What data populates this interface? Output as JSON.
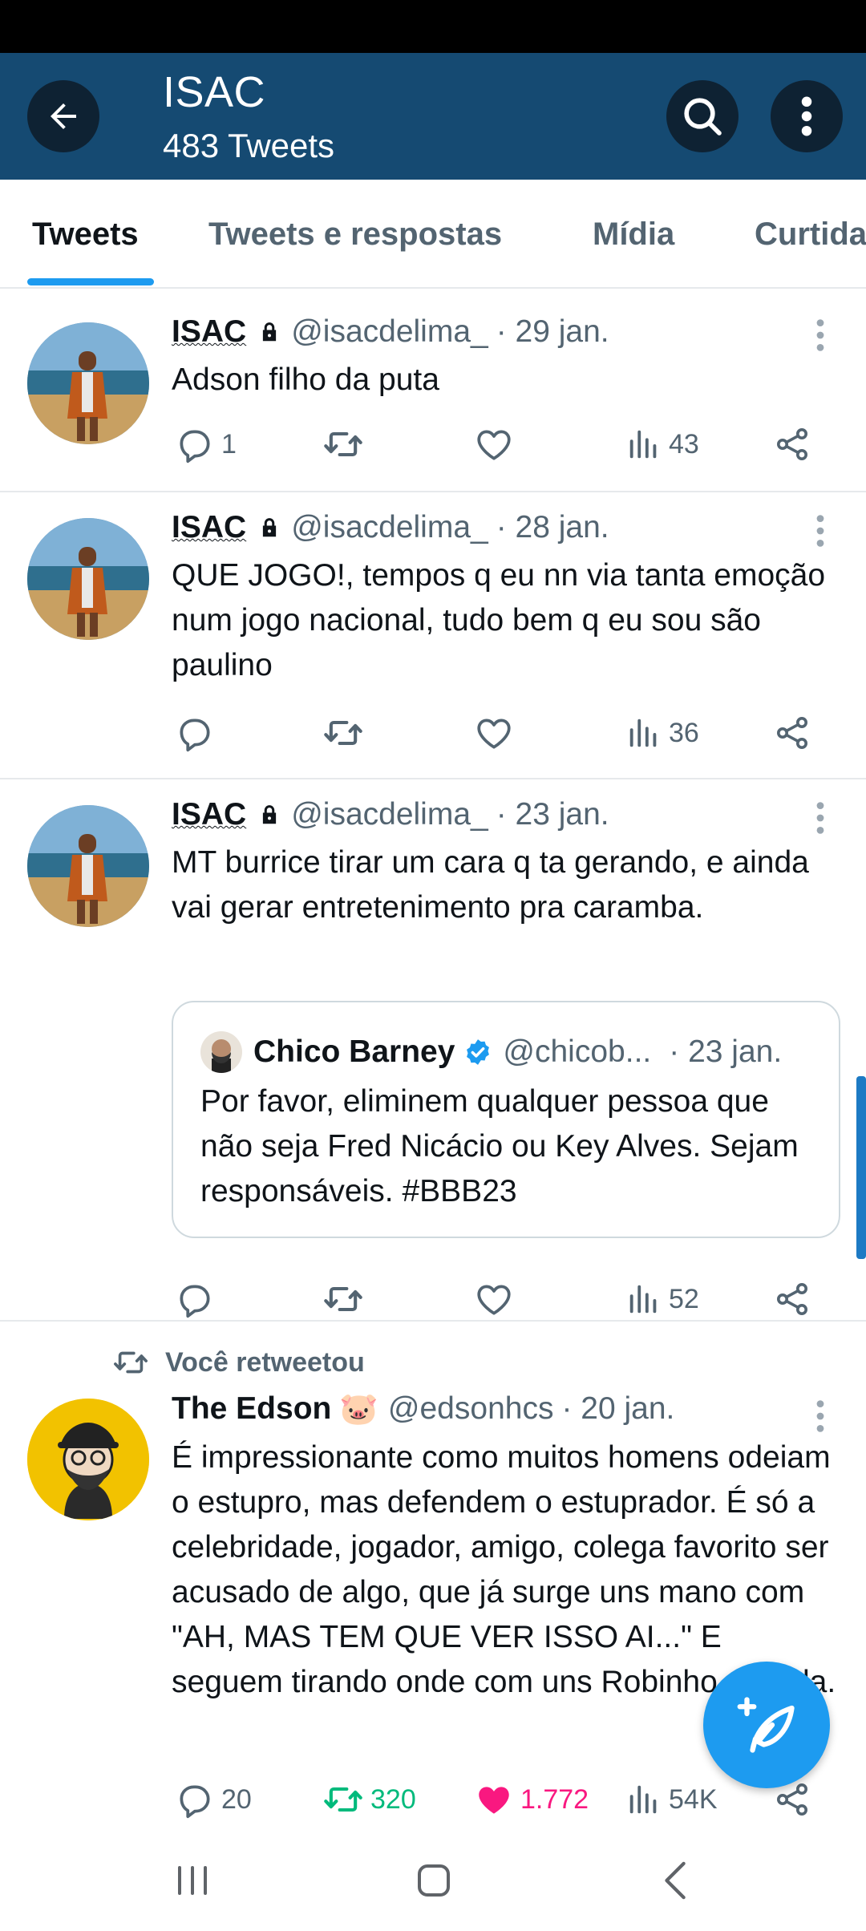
{
  "header": {
    "title": "ISAC",
    "subtitle": "483 Tweets"
  },
  "tabs": [
    {
      "label": "Tweets",
      "active": true
    },
    {
      "label": "Tweets e respostas",
      "active": false
    },
    {
      "label": "Mídia",
      "active": false
    },
    {
      "label": "Curtidas",
      "active": false
    }
  ],
  "tweets": [
    {
      "name": "ISAC",
      "protected": true,
      "handle": "@isacdelima_",
      "date": "· 29 jan.",
      "text": "Adson filho da puta",
      "replies": "1",
      "retweets": "",
      "likes": "",
      "views": "43"
    },
    {
      "name": "ISAC",
      "protected": true,
      "handle": "@isacdelima_",
      "date": "· 28 jan.",
      "text": "QUE JOGO!, tempos q eu nn via tanta emoção num jogo nacional, tudo bem q eu sou são paulino",
      "replies": "",
      "retweets": "",
      "likes": "",
      "views": "36"
    },
    {
      "name": "ISAC",
      "protected": true,
      "handle": "@isacdelima_",
      "date": "· 23 jan.",
      "text": "MT burrice tirar um cara q ta gerando, e ainda vai gerar entretenimento pra caramba.",
      "quote": {
        "name": "Chico Barney",
        "verified": true,
        "handle": "@chicob...",
        "date": "· 23 jan.",
        "text": "Por favor, eliminem qualquer pessoa que não seja Fred Nicácio ou Key Alves. Sejam responsáveis. #BBB23"
      },
      "replies": "",
      "retweets": "",
      "likes": "",
      "views": "52"
    },
    {
      "retweet_label": "Você retweetou",
      "name": "The Edson",
      "emoji": "🐷",
      "handle": "@edsonhcs",
      "date": "· 20 jan.",
      "text": "É impressionante como muitos homens odeiam o estupro, mas defendem o estuprador. É só a celebridade, jogador, amigo, colega favorito ser acusado de algo, que já surge uns mano com \"AH, MAS TEM QUE VER ISSO AI...\" E seguem tirando onde com uns Robinho da vida.",
      "replies": "20",
      "retweets": "320",
      "likes": "1.772",
      "views": "54K",
      "retweeted": true,
      "liked": true
    }
  ],
  "colors": {
    "header_bg": "#154a72",
    "accent": "#1d9bf0",
    "retweet_green": "#00ba7c",
    "like_pink": "#f91880",
    "muted": "#536471"
  },
  "icons": [
    "back-arrow-icon",
    "search-icon",
    "more-vertical-icon",
    "lock-icon",
    "reply-icon",
    "retweet-icon",
    "like-icon",
    "views-icon",
    "share-icon",
    "verified-icon",
    "compose-icon"
  ]
}
